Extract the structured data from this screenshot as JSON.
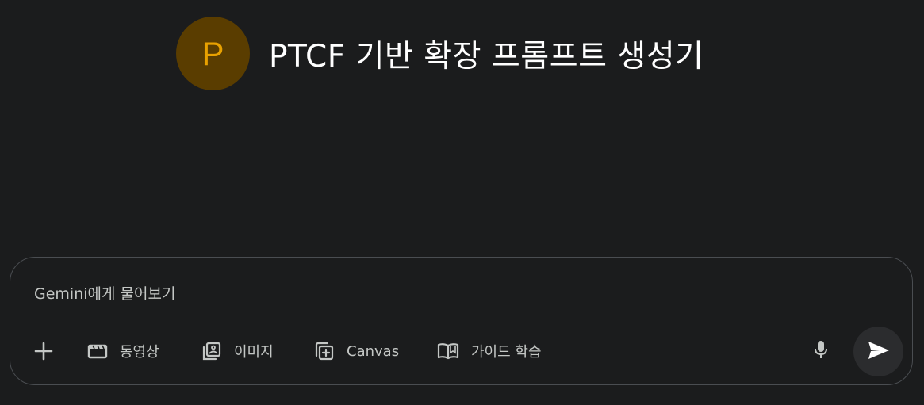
{
  "header": {
    "avatar_letter": "P",
    "title": "PTCF 기반 확장 프롬프트 생성기"
  },
  "composer": {
    "placeholder": "Gemini에게 물어보기",
    "tools": {
      "video": "동영상",
      "image": "이미지",
      "canvas": "Canvas",
      "guide": "가이드 학습"
    }
  },
  "icons": {
    "add": "plus-icon",
    "video": "clapperboard-icon",
    "image": "image-stack-icon",
    "canvas": "canvas-add-icon",
    "guide": "open-book-icon",
    "mic": "microphone-icon",
    "send": "send-icon"
  },
  "colors": {
    "background": "#1b1c1d",
    "avatar_bg": "#5a3d00",
    "avatar_fg": "#e8a100",
    "composer_border": "#4a4d51",
    "send_bg": "#2b2c2e"
  }
}
